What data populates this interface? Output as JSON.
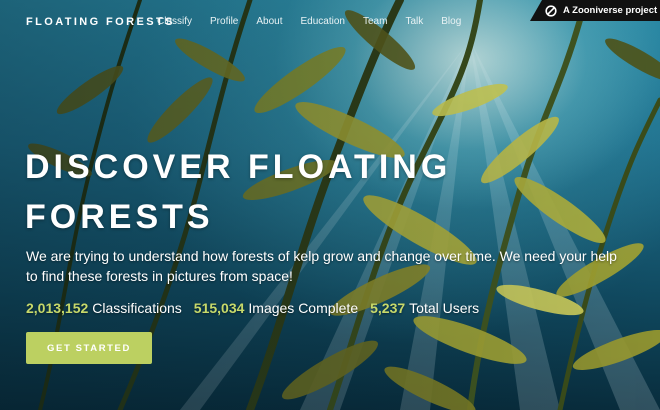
{
  "nav": {
    "brand": "FLOATING FORESTS",
    "links": [
      "Classify",
      "Profile",
      "About",
      "Education",
      "Team",
      "Talk",
      "Blog"
    ],
    "zooniverse_badge": "A Zooniverse project",
    "zooniverse_icon": "zooniverse-logo-icon"
  },
  "hero": {
    "title": "DISCOVER FLOATING FORESTS",
    "subtitle": "We are trying to understand how forests of kelp grow and change over time. We need your help to find these forests in pictures from space!",
    "stats": [
      {
        "value": "2,013,152",
        "label": "Classifications"
      },
      {
        "value": "515,034",
        "label": "Images Complete"
      },
      {
        "value": "5,237",
        "label": "Total Users"
      }
    ],
    "cta_label": "GET STARTED"
  },
  "colors": {
    "accent": "#bcd061",
    "stat_number": "#c7d96a",
    "badge_bg": "#111111"
  }
}
